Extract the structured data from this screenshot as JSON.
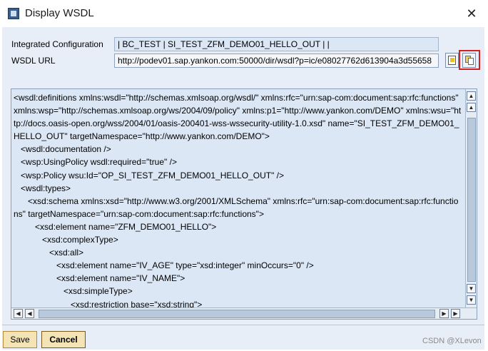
{
  "window": {
    "title": "Display WSDL",
    "close_glyph": "✕"
  },
  "form": {
    "integrated_configuration_label": "Integrated Configuration",
    "integrated_configuration_value": "| BC_TEST | SI_TEST_ZFM_DEMO01_HELLO_OUT |  |",
    "wsdl_url_label": "WSDL URL",
    "wsdl_url_value": "http://podev01.sap.yankon.com:50000/dir/wsdl?p=ic/e08027762d613904a3d55658"
  },
  "editor": {
    "content": "<wsdl:definitions xmlns:wsdl=\"http://schemas.xmlsoap.org/wsdl/\" xmlns:rfc=\"urn:sap-com:document:sap:rfc:functions\" xmlns:wsp=\"http://schemas.xmlsoap.org/ws/2004/09/policy\" xmlns:p1=\"http://www.yankon.com/DEMO\" xmlns:wsu=\"http://docs.oasis-open.org/wss/2004/01/oasis-200401-wss-wssecurity-utility-1.0.xsd\" name=\"SI_TEST_ZFM_DEMO01_HELLO_OUT\" targetNamespace=\"http://www.yankon.com/DEMO\">\n   <wsdl:documentation />\n   <wsp:UsingPolicy wsdl:required=\"true\" />\n   <wsp:Policy wsu:Id=\"OP_SI_TEST_ZFM_DEMO01_HELLO_OUT\" />\n   <wsdl:types>\n      <xsd:schema xmlns:xsd=\"http://www.w3.org/2001/XMLSchema\" xmlns:rfc=\"urn:sap-com:document:sap:rfc:functions\" targetNamespace=\"urn:sap-com:document:sap:rfc:functions\">\n         <xsd:element name=\"ZFM_DEMO01_HELLO\">\n            <xsd:complexType>\n               <xsd:all>\n                  <xsd:element name=\"IV_AGE\" type=\"xsd:integer\" minOccurs=\"0\" />\n                  <xsd:element name=\"IV_NAME\">\n                     <xsd:simpleType>\n                        <xsd:restriction base=\"xsd:string\">"
  },
  "footer": {
    "save_label": "Save",
    "cancel_label": "Cancel",
    "watermark": "CSDN @XLevon"
  }
}
